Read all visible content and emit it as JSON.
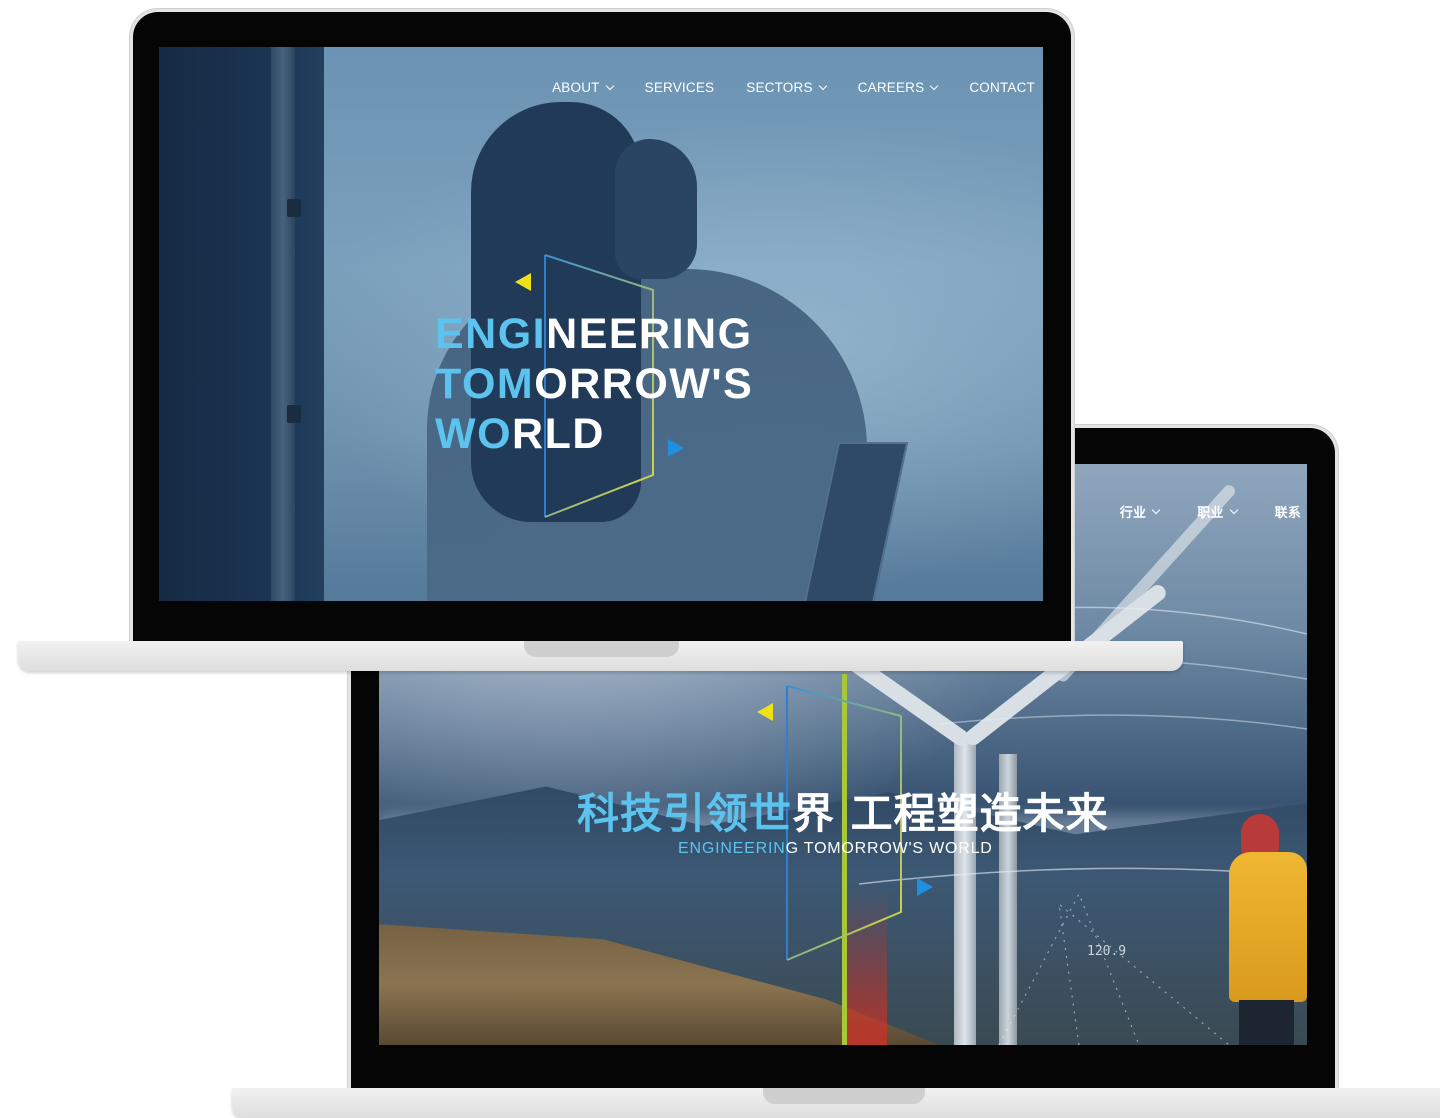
{
  "front_site": {
    "nav": [
      {
        "label": "ABOUT",
        "dropdown": true
      },
      {
        "label": "SERVICES",
        "dropdown": false
      },
      {
        "label": "SECTORS",
        "dropdown": true
      },
      {
        "label": "CAREERS",
        "dropdown": true
      },
      {
        "label": "CONTACT",
        "dropdown": false
      }
    ],
    "hero": {
      "line1_highlight": "ENGI",
      "line1_rest": "NEERING",
      "line2_highlight": "TOM",
      "line2_rest": "ORROW'S",
      "line3_highlight": "WO",
      "line3_rest": "RLD"
    }
  },
  "back_site": {
    "nav": [
      {
        "label": "行业",
        "dropdown": true
      },
      {
        "label": "职业",
        "dropdown": true
      },
      {
        "label": "联系",
        "dropdown": false
      }
    ],
    "hero": {
      "cn_highlight": "科技引领世",
      "cn_rest": "界 工程塑造未来",
      "sub_highlight": "ENGINEERIN",
      "sub_rest": "G TOMORROW'S WORLD"
    },
    "data_label": "120.9"
  },
  "colors": {
    "accent_blue": "#5cc3ef",
    "accent_yellow": "#f0e01a",
    "arrow_blue": "#1f8fe0",
    "bezel": "#050505"
  }
}
